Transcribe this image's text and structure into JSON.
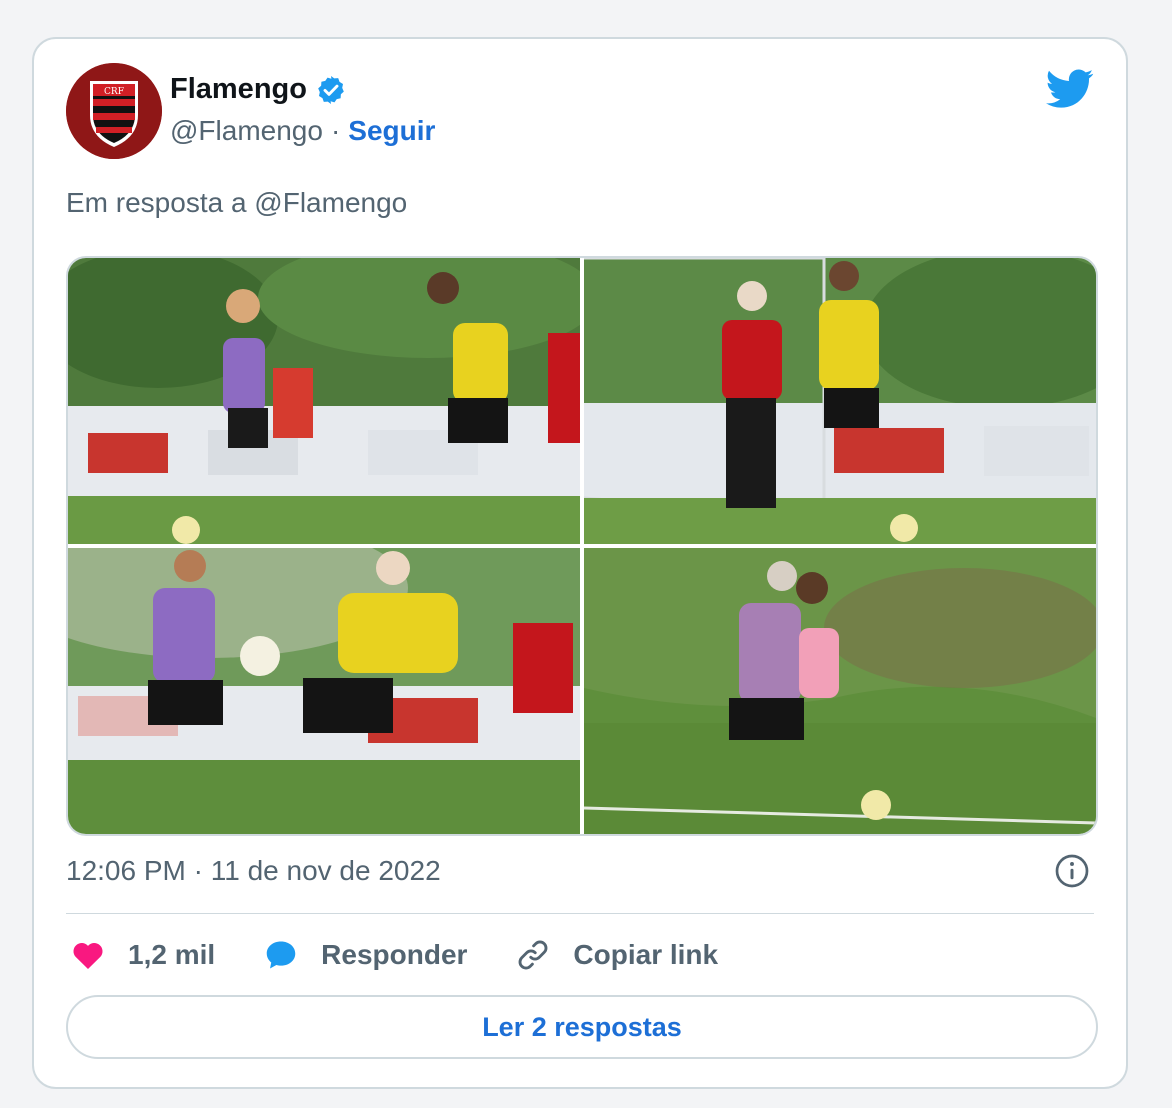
{
  "account": {
    "display_name": "Flamengo",
    "handle": "@Flamengo",
    "separator": "·",
    "follow_label": "Seguir"
  },
  "tweet": {
    "reply_to_text": "Em resposta a @Flamengo",
    "timestamp": "12:06 PM · 11 de nov de 2022"
  },
  "actions": {
    "likes_count": "1,2 mil",
    "reply_label": "Responder",
    "copy_link_label": "Copiar link"
  },
  "replies_button_label": "Ler 2 respostas",
  "colors": {
    "brand_blue": "#1d9bf0",
    "link_blue": "#1d6fd6",
    "like_pink": "#f91880",
    "flamengo_red": "#c4161c"
  },
  "icons": [
    "flamengo-crest-icon",
    "verified-badge-icon",
    "twitter-bird-icon",
    "info-icon",
    "heart-icon",
    "reply-bubble-icon",
    "link-icon"
  ]
}
